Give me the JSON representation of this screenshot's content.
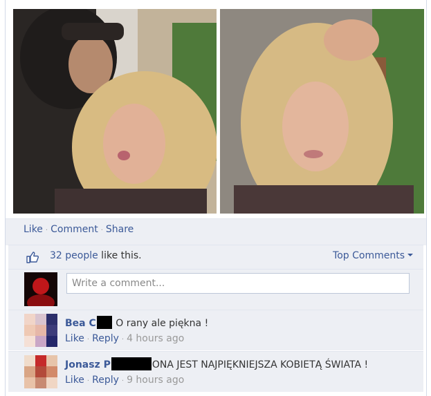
{
  "photos": [
    {
      "name": "photo-couple-selfie"
    },
    {
      "name": "photo-woman-selfie"
    }
  ],
  "actions": {
    "like": "Like",
    "comment": "Comment",
    "share": "Share"
  },
  "likes": {
    "icon": "thumbs-up-icon",
    "count_text": "32 people",
    "suffix": " like this.",
    "top_comments": "Top Comments"
  },
  "compose": {
    "placeholder": "Write a comment..."
  },
  "comments": [
    {
      "name": "Bea C",
      "text": "O rany ale piękna !",
      "like": "Like",
      "reply": "Reply",
      "time": "4 hours ago"
    },
    {
      "name": "Jonasz P",
      "text": "ONA JEST NAJPIĘKNIEJSZA KOBIETĄ ŚWIATA !",
      "like": "Like",
      "reply": "Reply",
      "time": "9 hours ago"
    }
  ],
  "colors": {
    "link": "#3b5998",
    "panel_bg": "#edeff4"
  }
}
